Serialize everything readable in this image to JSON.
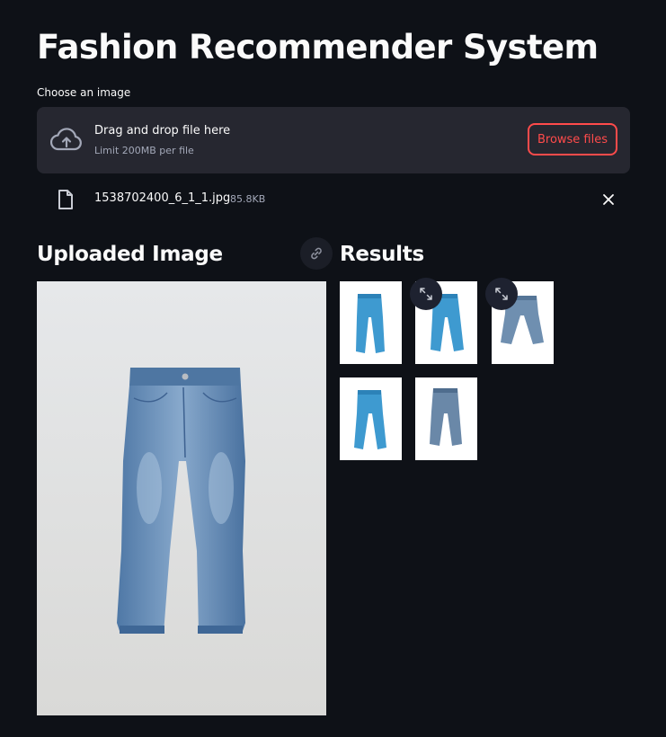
{
  "page": {
    "title": "Fashion Recommender System"
  },
  "uploader": {
    "label": "Choose an image",
    "drag_text": "Drag and drop file here",
    "limit_text": "Limit 200MB per file",
    "browse_label": "Browse files",
    "accent_color": "#ff4b4b"
  },
  "file": {
    "name": "1538702400_6_1_1.jpg",
    "size": "85.8KB",
    "icon": "file-icon",
    "remove_icon": "close-icon"
  },
  "uploaded_section": {
    "heading": "Uploaded Image",
    "link_icon": "link-icon"
  },
  "results_section": {
    "heading": "Results",
    "expand_icon": "expand-icon",
    "items": [
      {
        "wash": "bright-blue"
      },
      {
        "wash": "bright-blue"
      },
      {
        "wash": "grey-blue"
      },
      {
        "wash": "bright-blue"
      },
      {
        "wash": "grey-blue"
      }
    ]
  },
  "colors": {
    "background": "#0e1117",
    "panel": "#262730",
    "text": "#fafafa",
    "muted": "#a3a8b8"
  }
}
